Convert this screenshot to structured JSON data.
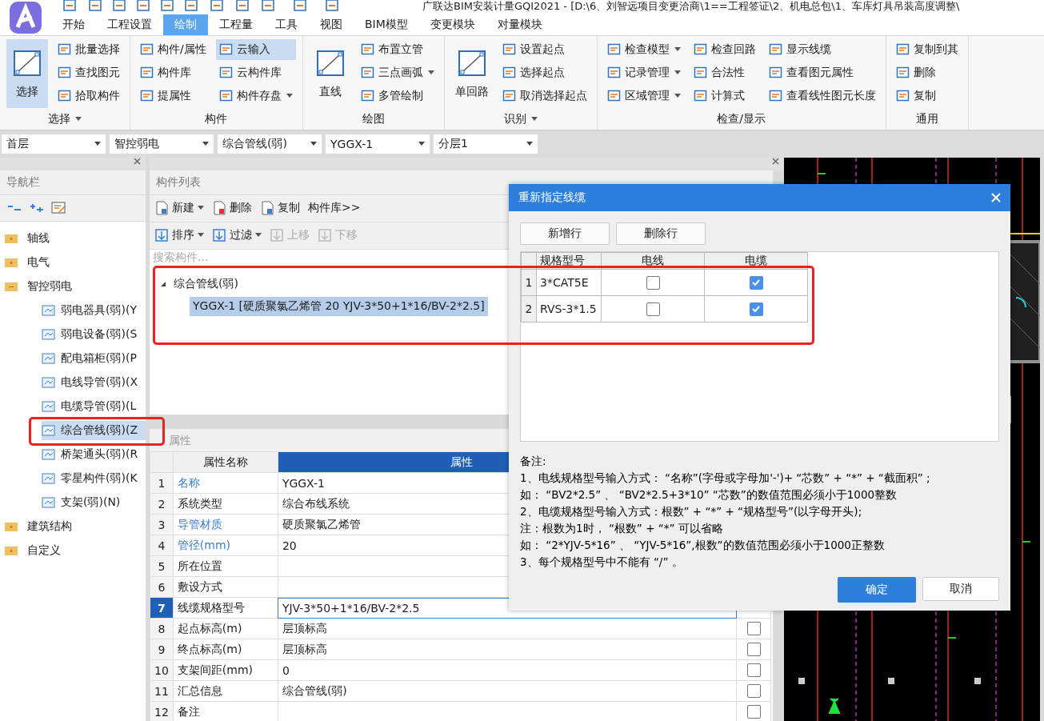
{
  "app_title": "广联达BIM安装计量GQI2021 - [D:\\6、刘智远项目变更洽商\\1==工程签证\\2、机电总包\\1、车库灯具吊装高度调整\\",
  "ribbon_tabs": [
    {
      "label": "开始",
      "selected": false
    },
    {
      "label": "工程设置",
      "selected": false
    },
    {
      "label": "绘制",
      "selected": true
    },
    {
      "label": "工程量",
      "selected": false
    },
    {
      "label": "工具",
      "selected": false
    },
    {
      "label": "视图",
      "selected": false
    },
    {
      "label": "BIM模型",
      "selected": false
    },
    {
      "label": "变更模块",
      "selected": false
    },
    {
      "label": "对量模块",
      "selected": false
    }
  ],
  "ribbon_groups": [
    {
      "label": "选择",
      "dropdown": true,
      "large": [
        {
          "label": "选择",
          "active": true
        }
      ],
      "columns": [
        [
          {
            "label": "批量选择",
            "dropdown": false,
            "active": false
          },
          {
            "label": "查找图元",
            "dropdown": false,
            "active": false
          },
          {
            "label": "拾取构件",
            "dropdown": false,
            "active": false
          }
        ]
      ]
    },
    {
      "label": "构件",
      "dropdown": false,
      "columns": [
        [
          {
            "label": "构件/属性",
            "dropdown": false,
            "active": false
          },
          {
            "label": "构件库",
            "dropdown": false,
            "active": false
          },
          {
            "label": "提属性",
            "dropdown": false,
            "active": false
          }
        ],
        [
          {
            "label": "云输入",
            "dropdown": false,
            "active": true
          },
          {
            "label": "云构件库",
            "dropdown": false,
            "active": false
          },
          {
            "label": "构件存盘",
            "dropdown": true,
            "active": false
          }
        ]
      ]
    },
    {
      "label": "绘图",
      "dropdown": false,
      "large": [
        {
          "label": "直线",
          "active": false
        }
      ],
      "columns": [
        [
          {
            "label": "布置立管",
            "dropdown": false,
            "active": false
          },
          {
            "label": "三点画弧",
            "dropdown": true,
            "active": false
          },
          {
            "label": "多管绘制",
            "dropdown": false,
            "active": false
          }
        ]
      ]
    },
    {
      "label": "识别",
      "dropdown": true,
      "large": [
        {
          "label": "单回路",
          "active": false
        }
      ],
      "columns": [
        [
          {
            "label": "设置起点",
            "dropdown": false,
            "active": false
          },
          {
            "label": "选择起点",
            "dropdown": false,
            "active": false
          },
          {
            "label": "取消选择起点",
            "dropdown": false,
            "active": false
          }
        ]
      ]
    },
    {
      "label": "检查/显示",
      "dropdown": false,
      "columns": [
        [
          {
            "label": "检查模型",
            "dropdown": true,
            "active": false
          },
          {
            "label": "记录管理",
            "dropdown": true,
            "active": false
          },
          {
            "label": "区域管理",
            "dropdown": true,
            "active": false
          }
        ],
        [
          {
            "label": "检查回路",
            "dropdown": false,
            "active": false
          },
          {
            "label": "合法性",
            "dropdown": false,
            "active": false
          },
          {
            "label": "计算式",
            "dropdown": false,
            "active": false
          }
        ],
        [
          {
            "label": "显示线缆",
            "dropdown": false,
            "active": false
          },
          {
            "label": "查看图元属性",
            "dropdown": false,
            "active": false
          },
          {
            "label": "查看线性图元长度",
            "dropdown": false,
            "active": false
          }
        ]
      ]
    },
    {
      "label": "通用",
      "dropdown": false,
      "columns": [
        [
          {
            "label": "复制到其",
            "dropdown": false,
            "active": false
          },
          {
            "label": "删除",
            "dropdown": false,
            "active": false
          },
          {
            "label": "复制",
            "dropdown": false,
            "active": false
          }
        ]
      ]
    }
  ],
  "selectors": [
    "首层",
    "智控弱电",
    "综合管线(弱)",
    "YGGX-1",
    "分层1"
  ],
  "nav": {
    "title": "导航栏",
    "items": [
      {
        "label": "轴线",
        "expanded": false
      },
      {
        "label": "电气",
        "expanded": false
      },
      {
        "label": "智控弱电",
        "expanded": true,
        "children": [
          {
            "label": "弱电器具(弱)(Y",
            "selected": false
          },
          {
            "label": "弱电设备(弱)(S",
            "selected": false
          },
          {
            "label": "配电箱柜(弱)(P",
            "selected": false
          },
          {
            "label": "电线导管(弱)(X",
            "selected": false
          },
          {
            "label": "电缆导管(弱)(L",
            "selected": false
          },
          {
            "label": "综合管线(弱)(Z",
            "selected": true
          },
          {
            "label": "桥架通头(弱)(R",
            "selected": false
          },
          {
            "label": "零星构件(弱)(K",
            "selected": false
          },
          {
            "label": "支架(弱)(N)",
            "selected": false
          }
        ]
      },
      {
        "label": "建筑结构",
        "expanded": false
      },
      {
        "label": "自定义",
        "expanded": false
      }
    ]
  },
  "component_list": {
    "title": "构件列表",
    "toolbar": [
      {
        "label": "新建",
        "dropdown": true,
        "disabled": false
      },
      {
        "label": "删除",
        "dropdown": false,
        "disabled": false
      },
      {
        "label": "复制",
        "dropdown": false,
        "disabled": false
      }
    ],
    "library_link": "构件库>>",
    "toolbar2": [
      {
        "label": "排序",
        "dropdown": true,
        "disabled": false
      },
      {
        "label": "过滤",
        "dropdown": true,
        "disabled": false
      },
      {
        "label": "上移",
        "dropdown": false,
        "disabled": true
      },
      {
        "label": "下移",
        "dropdown": false,
        "disabled": true
      }
    ],
    "search": {
      "placeholder": "搜索构件..."
    },
    "tree": [
      {
        "label": "综合管线(弱)",
        "expanded": true,
        "children": [
          {
            "label": "YGGX-1 [硬质聚氯乙烯管 20 YJV-3*50+1*16/BV-2*2.5]",
            "selected": true
          }
        ]
      }
    ]
  },
  "properties": {
    "title": "属性",
    "columns": [
      "属性名称",
      "属性"
    ],
    "rows": [
      {
        "index": "1",
        "name": "名称",
        "value": "YGGX-1",
        "public": true,
        "selected": false
      },
      {
        "index": "2",
        "name": "系统类型",
        "value": "综合布线系统",
        "public": false,
        "selected": false
      },
      {
        "index": "3",
        "name": "导管材质",
        "value": "硬质聚氯乙烯管",
        "public": true,
        "selected": false
      },
      {
        "index": "4",
        "name": "管径(mm)",
        "value": "20",
        "public": true,
        "selected": false
      },
      {
        "index": "5",
        "name": "所在位置",
        "value": "",
        "public": false,
        "selected": false
      },
      {
        "index": "6",
        "name": "敷设方式",
        "value": "",
        "public": false,
        "selected": false
      },
      {
        "index": "7",
        "name": "线缆规格型号",
        "value": "YJV-3*50+1*16/BV-2*2.5",
        "public": false,
        "selected": true
      },
      {
        "index": "8",
        "name": "起点标高(m)",
        "value": "层顶标高",
        "public": false,
        "selected": false,
        "checked": false
      },
      {
        "index": "9",
        "name": "终点标高(m)",
        "value": "层顶标高",
        "public": false,
        "selected": false,
        "checked": false
      },
      {
        "index": "10",
        "name": "支架间距(mm)",
        "value": "0",
        "public": false,
        "selected": false,
        "checked": false
      },
      {
        "index": "11",
        "name": "汇总信息",
        "value": "综合管线(弱)",
        "public": false,
        "selected": false,
        "checked": false
      },
      {
        "index": "12",
        "name": "备注",
        "value": "",
        "public": false,
        "selected": false,
        "checked": false
      }
    ]
  },
  "dialog": {
    "title": "重新指定线缆",
    "buttons": [
      "新增行",
      "删除行"
    ],
    "columns": [
      "规格型号",
      "电线",
      "电缆"
    ],
    "rows": [
      {
        "index": "1",
        "spec": "3*CAT5E",
        "wire": false,
        "cable": true
      },
      {
        "index": "2",
        "spec": "RVS-3*1.5",
        "wire": false,
        "cable": true
      }
    ],
    "notes": [
      "备注:",
      "1、电线规格型号输入方式： “名称”(字母或字母加'-')+ “芯数” + “*” + “截面积” ;",
      "如： “BV2*2.5” 、 “BV2*2.5+3*10”  “芯数”的数值范围必须小于1000整数",
      "2、电缆规格型号输入方式：根数” + “*”  + “规格型号”(以字母开头);",
      "注：根数为1时， “根数” + “*”  可以省略",
      "如： “2*YJV-5*16” 、 “YJV-5*16”,根数”的数值范围必须小于1000正整数",
      "3、每个规格型号中不能有 “/” 。"
    ],
    "ok": "确定",
    "cancel": "取消"
  }
}
